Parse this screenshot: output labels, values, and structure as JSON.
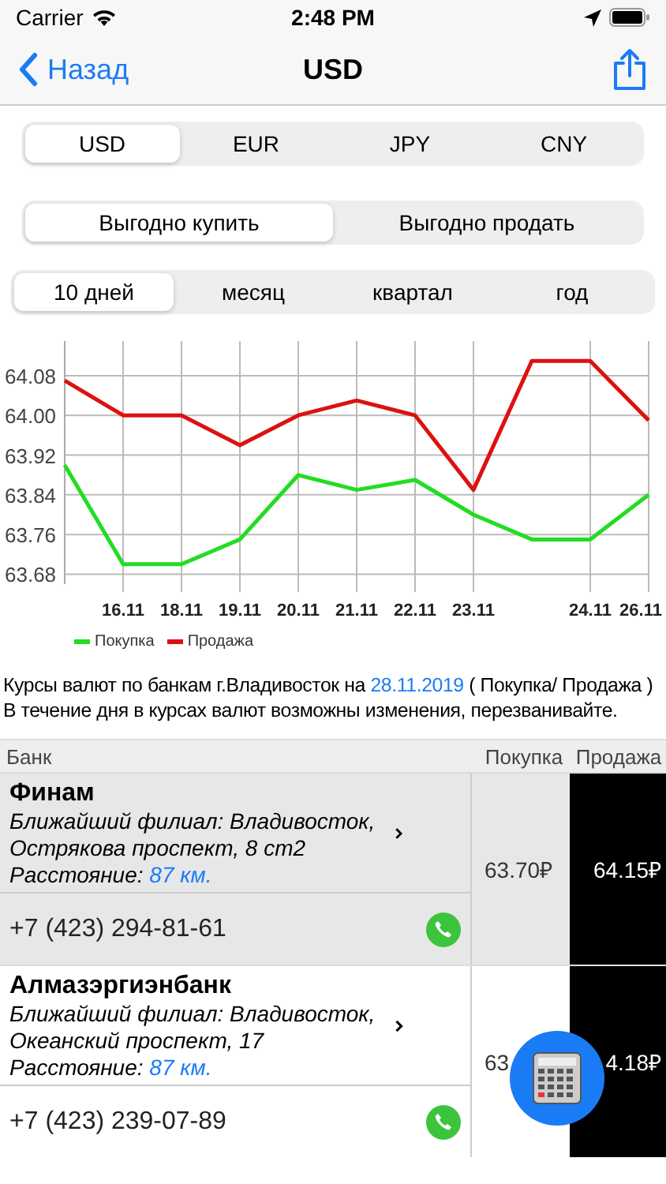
{
  "status_bar": {
    "carrier": "Carrier",
    "time": "2:48 PM"
  },
  "nav": {
    "back": "Назад",
    "title": "USD"
  },
  "currency_tabs": [
    {
      "label": "USD",
      "selected": true
    },
    {
      "label": "EUR",
      "selected": false
    },
    {
      "label": "JPY",
      "selected": false
    },
    {
      "label": "CNY",
      "selected": false
    }
  ],
  "mode_tabs": [
    {
      "label": "Выгодно купить",
      "selected": true
    },
    {
      "label": "Выгодно продать",
      "selected": false
    }
  ],
  "period_tabs": [
    {
      "label": "10 дней",
      "selected": true
    },
    {
      "label": "месяц",
      "selected": false
    },
    {
      "label": "квартал",
      "selected": false
    },
    {
      "label": "год",
      "selected": false
    }
  ],
  "chart": {
    "chart_data": {
      "type": "line",
      "grid": true,
      "categories": [
        null,
        "16.11",
        "18.11",
        "19.11",
        "20.11",
        "21.11",
        "22.11",
        "23.11",
        null,
        "24.11",
        "26.11"
      ],
      "ylim": [
        63.66,
        64.15
      ],
      "yticks": [
        {
          "value": 63.68,
          "label": "63.68"
        },
        {
          "value": 63.76,
          "label": "63.76"
        },
        {
          "value": 63.84,
          "label": "63.84"
        },
        {
          "value": 63.92,
          "label": "63.92"
        },
        {
          "value": 64.0,
          "label": "64.00"
        },
        {
          "value": 64.08,
          "label": "64.08"
        }
      ],
      "series": [
        {
          "name": "Покупка",
          "color": "#22dd22",
          "values": [
            63.9,
            63.7,
            63.7,
            63.75,
            63.88,
            63.85,
            63.87,
            63.8,
            63.75,
            63.75,
            63.84
          ]
        },
        {
          "name": "Продажа",
          "color": "#dd1111",
          "values": [
            64.07,
            64.0,
            64.0,
            63.94,
            64.0,
            64.03,
            64.0,
            63.85,
            64.11,
            64.11,
            63.99
          ]
        }
      ]
    }
  },
  "intro": {
    "before": "Курсы валют по банкам г.Владивосток на ",
    "date": "28.11.2019",
    "after": " ( Покупка/ Продажа )",
    "note": "В течение дня в курсах валют возможны изменения, перезванивайте."
  },
  "table": {
    "columns": [
      "Банк",
      "Покупка",
      "Продажа"
    ],
    "rows": [
      {
        "name": "Финам",
        "branch": "Ближайший филиал: Владивосток, Острякова проспект, 8 ст2",
        "distance_label": "Расстояние: ",
        "distance": "87 км.",
        "phone": "+7 (423) 294-81-61",
        "buy": "63.70₽",
        "sell": "64.15₽",
        "selected": true
      },
      {
        "name": "Алмазэргиэнбанк",
        "branch": "Ближайший филиал: Владивосток, Океанский проспект, 17",
        "distance_label": "Расстояние: ",
        "distance": "87 км.",
        "phone": "+7 (423) 239-07-89",
        "buy": "63",
        "sell": "4.18₽",
        "selected": false
      }
    ]
  }
}
